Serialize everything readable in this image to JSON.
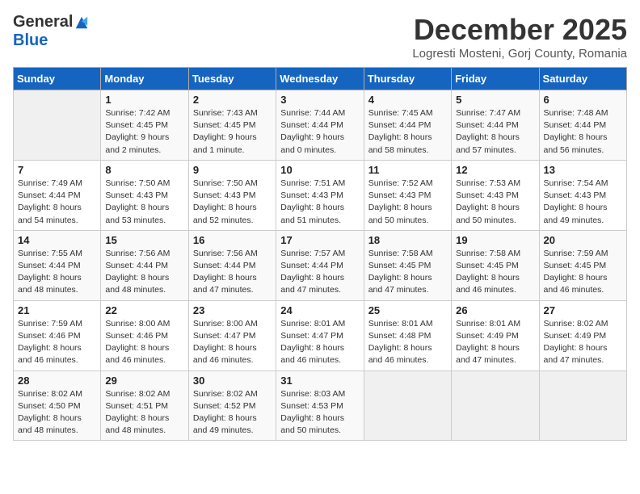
{
  "logo": {
    "general": "General",
    "blue": "Blue"
  },
  "title": "December 2025",
  "subtitle": "Logresti Mosteni, Gorj County, Romania",
  "days_of_week": [
    "Sunday",
    "Monday",
    "Tuesday",
    "Wednesday",
    "Thursday",
    "Friday",
    "Saturday"
  ],
  "weeks": [
    [
      {
        "day": "",
        "detail": ""
      },
      {
        "day": "1",
        "detail": "Sunrise: 7:42 AM\nSunset: 4:45 PM\nDaylight: 9 hours\nand 2 minutes."
      },
      {
        "day": "2",
        "detail": "Sunrise: 7:43 AM\nSunset: 4:45 PM\nDaylight: 9 hours\nand 1 minute."
      },
      {
        "day": "3",
        "detail": "Sunrise: 7:44 AM\nSunset: 4:44 PM\nDaylight: 9 hours\nand 0 minutes."
      },
      {
        "day": "4",
        "detail": "Sunrise: 7:45 AM\nSunset: 4:44 PM\nDaylight: 8 hours\nand 58 minutes."
      },
      {
        "day": "5",
        "detail": "Sunrise: 7:47 AM\nSunset: 4:44 PM\nDaylight: 8 hours\nand 57 minutes."
      },
      {
        "day": "6",
        "detail": "Sunrise: 7:48 AM\nSunset: 4:44 PM\nDaylight: 8 hours\nand 56 minutes."
      }
    ],
    [
      {
        "day": "7",
        "detail": "Sunrise: 7:49 AM\nSunset: 4:44 PM\nDaylight: 8 hours\nand 54 minutes."
      },
      {
        "day": "8",
        "detail": "Sunrise: 7:50 AM\nSunset: 4:43 PM\nDaylight: 8 hours\nand 53 minutes."
      },
      {
        "day": "9",
        "detail": "Sunrise: 7:50 AM\nSunset: 4:43 PM\nDaylight: 8 hours\nand 52 minutes."
      },
      {
        "day": "10",
        "detail": "Sunrise: 7:51 AM\nSunset: 4:43 PM\nDaylight: 8 hours\nand 51 minutes."
      },
      {
        "day": "11",
        "detail": "Sunrise: 7:52 AM\nSunset: 4:43 PM\nDaylight: 8 hours\nand 50 minutes."
      },
      {
        "day": "12",
        "detail": "Sunrise: 7:53 AM\nSunset: 4:43 PM\nDaylight: 8 hours\nand 50 minutes."
      },
      {
        "day": "13",
        "detail": "Sunrise: 7:54 AM\nSunset: 4:43 PM\nDaylight: 8 hours\nand 49 minutes."
      }
    ],
    [
      {
        "day": "14",
        "detail": "Sunrise: 7:55 AM\nSunset: 4:44 PM\nDaylight: 8 hours\nand 48 minutes."
      },
      {
        "day": "15",
        "detail": "Sunrise: 7:56 AM\nSunset: 4:44 PM\nDaylight: 8 hours\nand 48 minutes."
      },
      {
        "day": "16",
        "detail": "Sunrise: 7:56 AM\nSunset: 4:44 PM\nDaylight: 8 hours\nand 47 minutes."
      },
      {
        "day": "17",
        "detail": "Sunrise: 7:57 AM\nSunset: 4:44 PM\nDaylight: 8 hours\nand 47 minutes."
      },
      {
        "day": "18",
        "detail": "Sunrise: 7:58 AM\nSunset: 4:45 PM\nDaylight: 8 hours\nand 47 minutes."
      },
      {
        "day": "19",
        "detail": "Sunrise: 7:58 AM\nSunset: 4:45 PM\nDaylight: 8 hours\nand 46 minutes."
      },
      {
        "day": "20",
        "detail": "Sunrise: 7:59 AM\nSunset: 4:45 PM\nDaylight: 8 hours\nand 46 minutes."
      }
    ],
    [
      {
        "day": "21",
        "detail": "Sunrise: 7:59 AM\nSunset: 4:46 PM\nDaylight: 8 hours\nand 46 minutes."
      },
      {
        "day": "22",
        "detail": "Sunrise: 8:00 AM\nSunset: 4:46 PM\nDaylight: 8 hours\nand 46 minutes."
      },
      {
        "day": "23",
        "detail": "Sunrise: 8:00 AM\nSunset: 4:47 PM\nDaylight: 8 hours\nand 46 minutes."
      },
      {
        "day": "24",
        "detail": "Sunrise: 8:01 AM\nSunset: 4:47 PM\nDaylight: 8 hours\nand 46 minutes."
      },
      {
        "day": "25",
        "detail": "Sunrise: 8:01 AM\nSunset: 4:48 PM\nDaylight: 8 hours\nand 46 minutes."
      },
      {
        "day": "26",
        "detail": "Sunrise: 8:01 AM\nSunset: 4:49 PM\nDaylight: 8 hours\nand 47 minutes."
      },
      {
        "day": "27",
        "detail": "Sunrise: 8:02 AM\nSunset: 4:49 PM\nDaylight: 8 hours\nand 47 minutes."
      }
    ],
    [
      {
        "day": "28",
        "detail": "Sunrise: 8:02 AM\nSunset: 4:50 PM\nDaylight: 8 hours\nand 48 minutes."
      },
      {
        "day": "29",
        "detail": "Sunrise: 8:02 AM\nSunset: 4:51 PM\nDaylight: 8 hours\nand 48 minutes."
      },
      {
        "day": "30",
        "detail": "Sunrise: 8:02 AM\nSunset: 4:52 PM\nDaylight: 8 hours\nand 49 minutes."
      },
      {
        "day": "31",
        "detail": "Sunrise: 8:03 AM\nSunset: 4:53 PM\nDaylight: 8 hours\nand 50 minutes."
      },
      {
        "day": "",
        "detail": ""
      },
      {
        "day": "",
        "detail": ""
      },
      {
        "day": "",
        "detail": ""
      }
    ]
  ]
}
